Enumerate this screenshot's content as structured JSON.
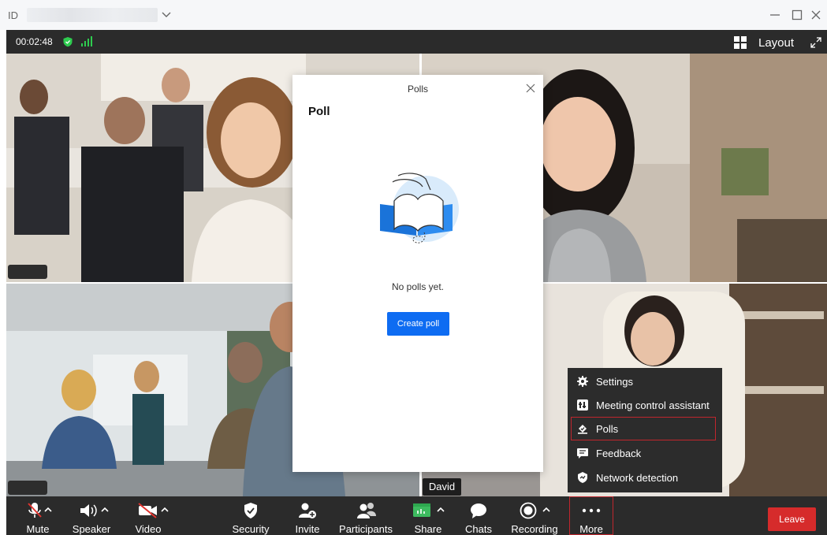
{
  "titlebar": {
    "id_label": "ID"
  },
  "status": {
    "timer": "00:02:48",
    "layout_label": "Layout"
  },
  "participants": {
    "active_speaker_name": "David"
  },
  "polls_dialog": {
    "title": "Polls",
    "heading": "Poll",
    "empty_text": "No polls yet.",
    "create_button": "Create poll"
  },
  "more_menu": {
    "items": [
      {
        "label": "Settings",
        "icon": "gear-icon"
      },
      {
        "label": "Meeting control assistant",
        "icon": "control-assistant-icon"
      },
      {
        "label": "Polls",
        "icon": "polls-icon",
        "selected": true
      },
      {
        "label": "Feedback",
        "icon": "feedback-icon"
      },
      {
        "label": "Network detection",
        "icon": "network-detection-icon"
      }
    ]
  },
  "toolbar": {
    "mute": "Mute",
    "speaker": "Speaker",
    "video": "Video",
    "security": "Security",
    "invite": "Invite",
    "participants": "Participants",
    "share": "Share",
    "chats": "Chats",
    "recording": "Recording",
    "more": "More",
    "leave": "Leave"
  },
  "colors": {
    "accent_blue": "#0e6cf2",
    "leave_red": "#d62b2b",
    "highlight_red": "#c0262d",
    "security_green": "#2ecc4f",
    "share_green": "#3dbb5f"
  }
}
